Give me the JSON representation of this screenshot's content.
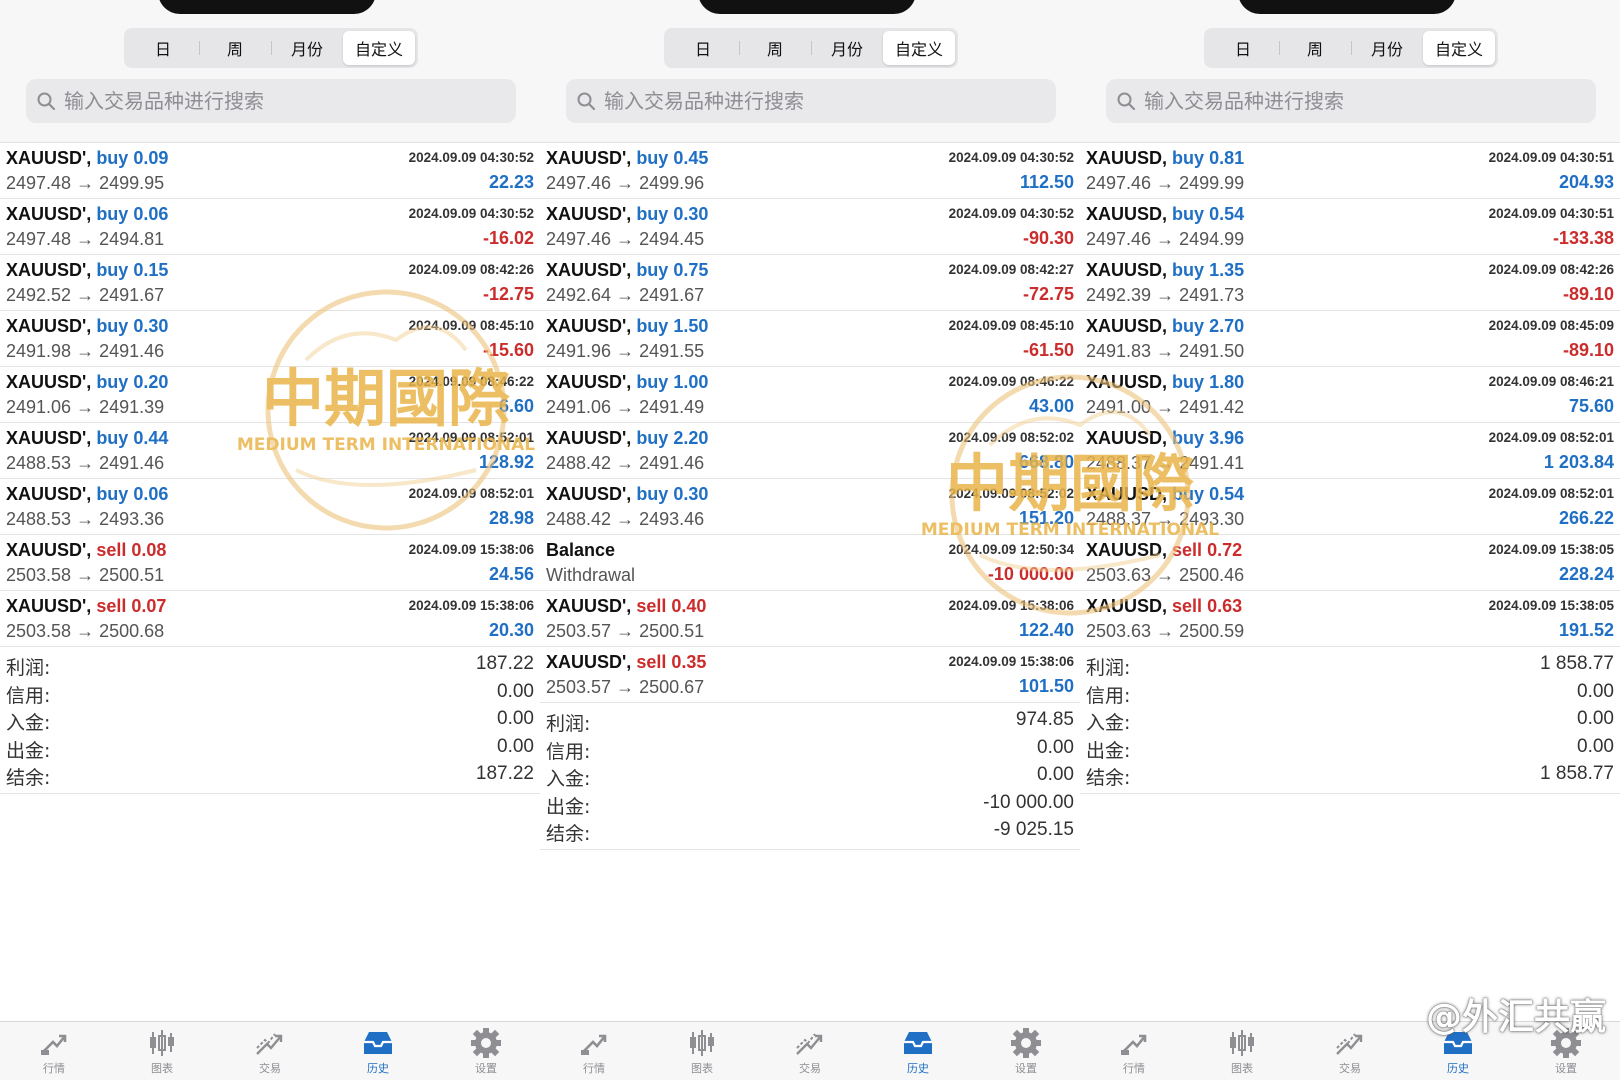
{
  "segments": [
    "日",
    "周",
    "月份",
    "自定义"
  ],
  "active_segment": 3,
  "search_placeholder": "输入交易品种进行搜索",
  "panels": [
    {
      "rows": [
        {
          "symbol": "XAUUSD',",
          "side": "buy",
          "lot": "0.09",
          "time": "2024.09.09 04:30:52",
          "prices": "2497.48 → 2499.95",
          "profit": "22.23",
          "sign": "pos"
        },
        {
          "symbol": "XAUUSD',",
          "side": "buy",
          "lot": "0.06",
          "time": "2024.09.09 04:30:52",
          "prices": "2497.48 → 2494.81",
          "profit": "-16.02",
          "sign": "neg"
        },
        {
          "symbol": "XAUUSD',",
          "side": "buy",
          "lot": "0.15",
          "time": "2024.09.09 08:42:26",
          "prices": "2492.52 → 2491.67",
          "profit": "-12.75",
          "sign": "neg"
        },
        {
          "symbol": "XAUUSD',",
          "side": "buy",
          "lot": "0.30",
          "time": "2024.09.09 08:45:10",
          "prices": "2491.98 → 2491.46",
          "profit": "-15.60",
          "sign": "neg"
        },
        {
          "symbol": "XAUUSD',",
          "side": "buy",
          "lot": "0.20",
          "time": "2024.09.09 08:46:22",
          "prices": "2491.06 → 2491.39",
          "profit": "6.60",
          "sign": "pos"
        },
        {
          "symbol": "XAUUSD',",
          "side": "buy",
          "lot": "0.44",
          "time": "2024.09.09 08:52:01",
          "prices": "2488.53 → 2491.46",
          "profit": "128.92",
          "sign": "pos"
        },
        {
          "symbol": "XAUUSD',",
          "side": "buy",
          "lot": "0.06",
          "time": "2024.09.09 08:52:01",
          "prices": "2488.53 → 2493.36",
          "profit": "28.98",
          "sign": "pos"
        },
        {
          "symbol": "XAUUSD',",
          "side": "sell",
          "lot": "0.08",
          "time": "2024.09.09 15:38:06",
          "prices": "2503.58 → 2500.51",
          "profit": "24.56",
          "sign": "pos"
        },
        {
          "symbol": "XAUUSD',",
          "side": "sell",
          "lot": "0.07",
          "time": "2024.09.09 15:38:06",
          "prices": "2503.58 → 2500.68",
          "profit": "20.30",
          "sign": "pos"
        }
      ],
      "summary": [
        {
          "label": "利润:",
          "value": "187.22"
        },
        {
          "label": "信用:",
          "value": "0.00"
        },
        {
          "label": "入金:",
          "value": "0.00"
        },
        {
          "label": "出金:",
          "value": "0.00"
        },
        {
          "label": "结余:",
          "value": "187.22"
        }
      ]
    },
    {
      "rows": [
        {
          "symbol": "XAUUSD',",
          "side": "buy",
          "lot": "0.45",
          "time": "2024.09.09 04:30:52",
          "prices": "2497.46 → 2499.96",
          "profit": "112.50",
          "sign": "pos"
        },
        {
          "symbol": "XAUUSD',",
          "side": "buy",
          "lot": "0.30",
          "time": "2024.09.09 04:30:52",
          "prices": "2497.46 → 2494.45",
          "profit": "-90.30",
          "sign": "neg"
        },
        {
          "symbol": "XAUUSD',",
          "side": "buy",
          "lot": "0.75",
          "time": "2024.09.09 08:42:27",
          "prices": "2492.64 → 2491.67",
          "profit": "-72.75",
          "sign": "neg"
        },
        {
          "symbol": "XAUUSD',",
          "side": "buy",
          "lot": "1.50",
          "time": "2024.09.09 08:45:10",
          "prices": "2491.96 → 2491.55",
          "profit": "-61.50",
          "sign": "neg"
        },
        {
          "symbol": "XAUUSD',",
          "side": "buy",
          "lot": "1.00",
          "time": "2024.09.09 08:46:22",
          "prices": "2491.06 → 2491.49",
          "profit": "43.00",
          "sign": "pos"
        },
        {
          "symbol": "XAUUSD',",
          "side": "buy",
          "lot": "2.20",
          "time": "2024.09.09 08:52:02",
          "prices": "2488.42 → 2491.46",
          "profit": "668.80",
          "sign": "pos"
        },
        {
          "symbol": "XAUUSD',",
          "side": "buy",
          "lot": "0.30",
          "time": "2024.09.09 08:52:02",
          "prices": "2488.42 → 2493.46",
          "profit": "151.20",
          "sign": "pos"
        },
        {
          "symbol": "Balance",
          "side": "",
          "lot": "",
          "time": "2024.09.09 12:50:34",
          "prices": "Withdrawal",
          "profit": "-10 000.00",
          "sign": "neg"
        },
        {
          "symbol": "XAUUSD',",
          "side": "sell",
          "lot": "0.40",
          "time": "2024.09.09 15:38:06",
          "prices": "2503.57 → 2500.51",
          "profit": "122.40",
          "sign": "pos"
        },
        {
          "symbol": "XAUUSD',",
          "side": "sell",
          "lot": "0.35",
          "time": "2024.09.09 15:38:06",
          "prices": "2503.57 → 2500.67",
          "profit": "101.50",
          "sign": "pos"
        }
      ],
      "summary": [
        {
          "label": "利润:",
          "value": "974.85"
        },
        {
          "label": "信用:",
          "value": "0.00"
        },
        {
          "label": "入金:",
          "value": "0.00"
        },
        {
          "label": "出金:",
          "value": "-10 000.00"
        },
        {
          "label": "结余:",
          "value": "-9 025.15"
        }
      ]
    },
    {
      "rows": [
        {
          "symbol": "XAUUSD,",
          "side": "buy",
          "lot": "0.81",
          "time": "2024.09.09 04:30:51",
          "prices": "2497.46 → 2499.99",
          "profit": "204.93",
          "sign": "pos"
        },
        {
          "symbol": "XAUUSD,",
          "side": "buy",
          "lot": "0.54",
          "time": "2024.09.09 04:30:51",
          "prices": "2497.46 → 2494.99",
          "profit": "-133.38",
          "sign": "neg"
        },
        {
          "symbol": "XAUUSD,",
          "side": "buy",
          "lot": "1.35",
          "time": "2024.09.09 08:42:26",
          "prices": "2492.39 → 2491.73",
          "profit": "-89.10",
          "sign": "neg"
        },
        {
          "symbol": "XAUUSD,",
          "side": "buy",
          "lot": "2.70",
          "time": "2024.09.09 08:45:09",
          "prices": "2491.83 → 2491.50",
          "profit": "-89.10",
          "sign": "neg"
        },
        {
          "symbol": "XAUUSD,",
          "side": "buy",
          "lot": "1.80",
          "time": "2024.09.09 08:46:21",
          "prices": "2491.00 → 2491.42",
          "profit": "75.60",
          "sign": "pos"
        },
        {
          "symbol": "XAUUSD,",
          "side": "buy",
          "lot": "3.96",
          "time": "2024.09.09 08:52:01",
          "prices": "2488.37 → 2491.41",
          "profit": "1 203.84",
          "sign": "pos"
        },
        {
          "symbol": "XAUUSD,",
          "side": "buy",
          "lot": "0.54",
          "time": "2024.09.09 08:52:01",
          "prices": "2488.37 → 2493.30",
          "profit": "266.22",
          "sign": "pos"
        },
        {
          "symbol": "XAUUSD,",
          "side": "sell",
          "lot": "0.72",
          "time": "2024.09.09 15:38:05",
          "prices": "2503.63 → 2500.46",
          "profit": "228.24",
          "sign": "pos"
        },
        {
          "symbol": "XAUUSD,",
          "side": "sell",
          "lot": "0.63",
          "time": "2024.09.09 15:38:05",
          "prices": "2503.63 → 2500.59",
          "profit": "191.52",
          "sign": "pos"
        }
      ],
      "summary": [
        {
          "label": "利润:",
          "value": "1 858.77"
        },
        {
          "label": "信用:",
          "value": "0.00"
        },
        {
          "label": "入金:",
          "value": "0.00"
        },
        {
          "label": "出金:",
          "value": "0.00"
        },
        {
          "label": "结余:",
          "value": "1 858.77"
        }
      ]
    }
  ],
  "tabs": [
    {
      "label": "行情",
      "icon": "quotes-icon"
    },
    {
      "label": "图表",
      "icon": "chart-icon"
    },
    {
      "label": "交易",
      "icon": "trade-icon"
    },
    {
      "label": "历史",
      "icon": "history-icon"
    },
    {
      "label": "设置",
      "icon": "settings-icon"
    }
  ],
  "active_tab": 3,
  "watermark": {
    "cn": "中期國際",
    "en": "MEDIUM TERM INTERNATIONAL"
  },
  "corner_watermark": "@外汇共赢",
  "colors": {
    "buy": "#1f6fc5",
    "sell": "#cc2c2c",
    "positive": "#1f6fc5",
    "negative": "#cc2c2c",
    "watermark": "#e9b54a"
  }
}
